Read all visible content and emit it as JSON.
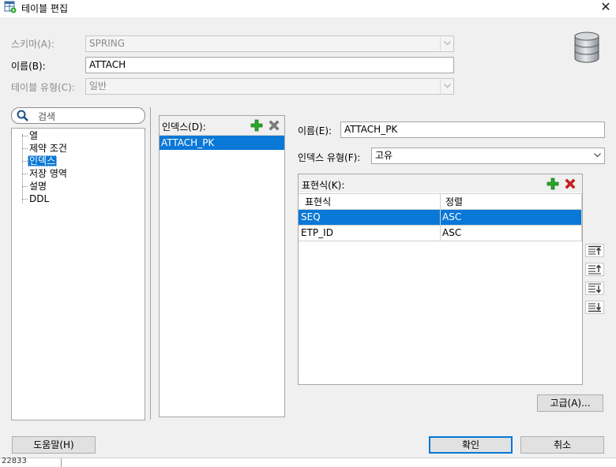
{
  "window": {
    "title": "테이블 편집",
    "close_glyph": "✕"
  },
  "form": {
    "schema_label": "스키마(A):",
    "schema_value": "SPRING",
    "name_label": "이름(B):",
    "name_value": "ATTACH",
    "table_type_label": "테이블 유형(C):",
    "table_type_value": "일반"
  },
  "search": {
    "placeholder": "검색"
  },
  "nav": {
    "items": [
      {
        "label": "열"
      },
      {
        "label": "제약 조건"
      },
      {
        "label": "인덱스"
      },
      {
        "label": "저장 영역"
      },
      {
        "label": "설명"
      },
      {
        "label": "DDL"
      }
    ],
    "selected": "인덱스"
  },
  "indexes": {
    "label": "인덱스(D):",
    "items": [
      "ATTACH_PK"
    ]
  },
  "index_detail": {
    "name_label": "이름(E):",
    "name_value": "ATTACH_PK",
    "type_label": "인덱스 유형(F):",
    "type_value": "고유",
    "expr_label": "표현식(K):",
    "columns": [
      "표현식",
      "정렬"
    ],
    "rows": [
      {
        "expr": "SEQ",
        "order": "ASC"
      },
      {
        "expr": "ETP_ID",
        "order": "ASC"
      }
    ]
  },
  "buttons": {
    "advanced": "고급(A)...",
    "help": "도움말(H)",
    "ok": "확인",
    "cancel": "취소"
  },
  "status": {
    "text": "22833"
  },
  "colors": {
    "selection": "#0a78d7",
    "add": "#2aa52a",
    "remove_active": "#d42020",
    "remove_disabled": "#808080"
  }
}
